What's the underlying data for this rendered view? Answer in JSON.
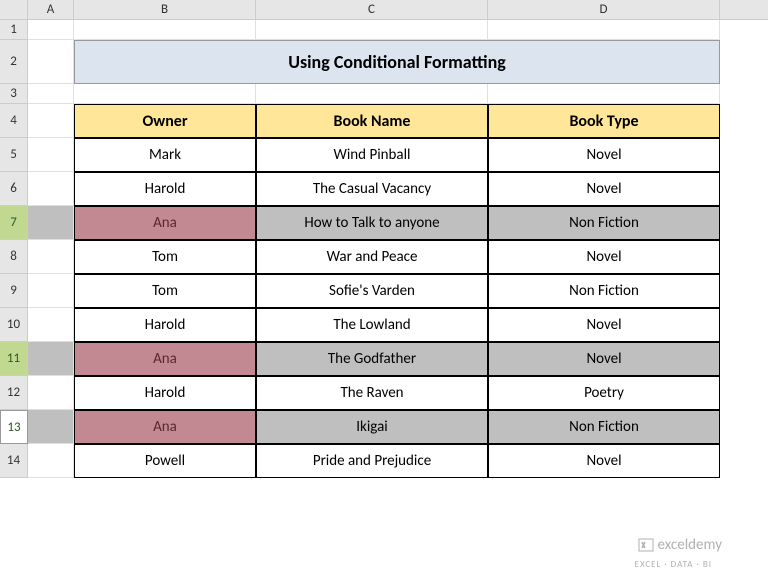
{
  "columns": [
    "A",
    "B",
    "C",
    "D"
  ],
  "rows": [
    "1",
    "2",
    "3",
    "4",
    "5",
    "6",
    "7",
    "8",
    "9",
    "10",
    "11",
    "12",
    "13",
    "14"
  ],
  "title": "Using Conditional Formatting",
  "headers": {
    "owner": "Owner",
    "book": "Book Name",
    "type": "Book Type"
  },
  "data": [
    {
      "owner": "Mark",
      "book": "Wind Pinball",
      "type": "Novel",
      "highlight": false
    },
    {
      "owner": "Harold",
      "book": "The Casual Vacancy",
      "type": "Novel",
      "highlight": false
    },
    {
      "owner": "Ana",
      "book": "How to Talk to anyone",
      "type": "Non Fiction",
      "highlight": true
    },
    {
      "owner": "Tom",
      "book": "War and Peace",
      "type": "Novel",
      "highlight": false
    },
    {
      "owner": "Tom",
      "book": "Sofie's Varden",
      "type": "Non Fiction",
      "highlight": false
    },
    {
      "owner": "Harold",
      "book": "The Lowland",
      "type": "Novel",
      "highlight": false
    },
    {
      "owner": "Ana",
      "book": "The Godfather",
      "type": "Novel",
      "highlight": true
    },
    {
      "owner": "Harold",
      "book": "The Raven",
      "type": "Poetry",
      "highlight": false
    },
    {
      "owner": "Ana",
      "book": "Ikigai",
      "type": "Non Fiction",
      "highlight": true
    },
    {
      "owner": "Powell",
      "book": "Pride and Prejudice",
      "type": "Novel",
      "highlight": false
    }
  ],
  "highlightedRowNumbers": [
    7,
    11,
    13
  ],
  "activeRow": 13,
  "watermark": {
    "brand": "exceldemy",
    "tagline": "EXCEL · DATA · BI"
  },
  "chart_data": {
    "type": "table",
    "title": "Using Conditional Formatting",
    "columns": [
      "Owner",
      "Book Name",
      "Book Type"
    ],
    "rows": [
      [
        "Mark",
        "Wind Pinball",
        "Novel"
      ],
      [
        "Harold",
        "The Casual Vacancy",
        "Novel"
      ],
      [
        "Ana",
        "How to Talk to anyone",
        "Non Fiction"
      ],
      [
        "Tom",
        "War and Peace",
        "Novel"
      ],
      [
        "Tom",
        "Sofie's Varden",
        "Non Fiction"
      ],
      [
        "Harold",
        "The Lowland",
        "Novel"
      ],
      [
        "Ana",
        "The Godfather",
        "Novel"
      ],
      [
        "Harold",
        "The Raven",
        "Poetry"
      ],
      [
        "Ana",
        "Ikigai",
        "Non Fiction"
      ],
      [
        "Powell",
        "Pride and Prejudice",
        "Novel"
      ]
    ]
  }
}
